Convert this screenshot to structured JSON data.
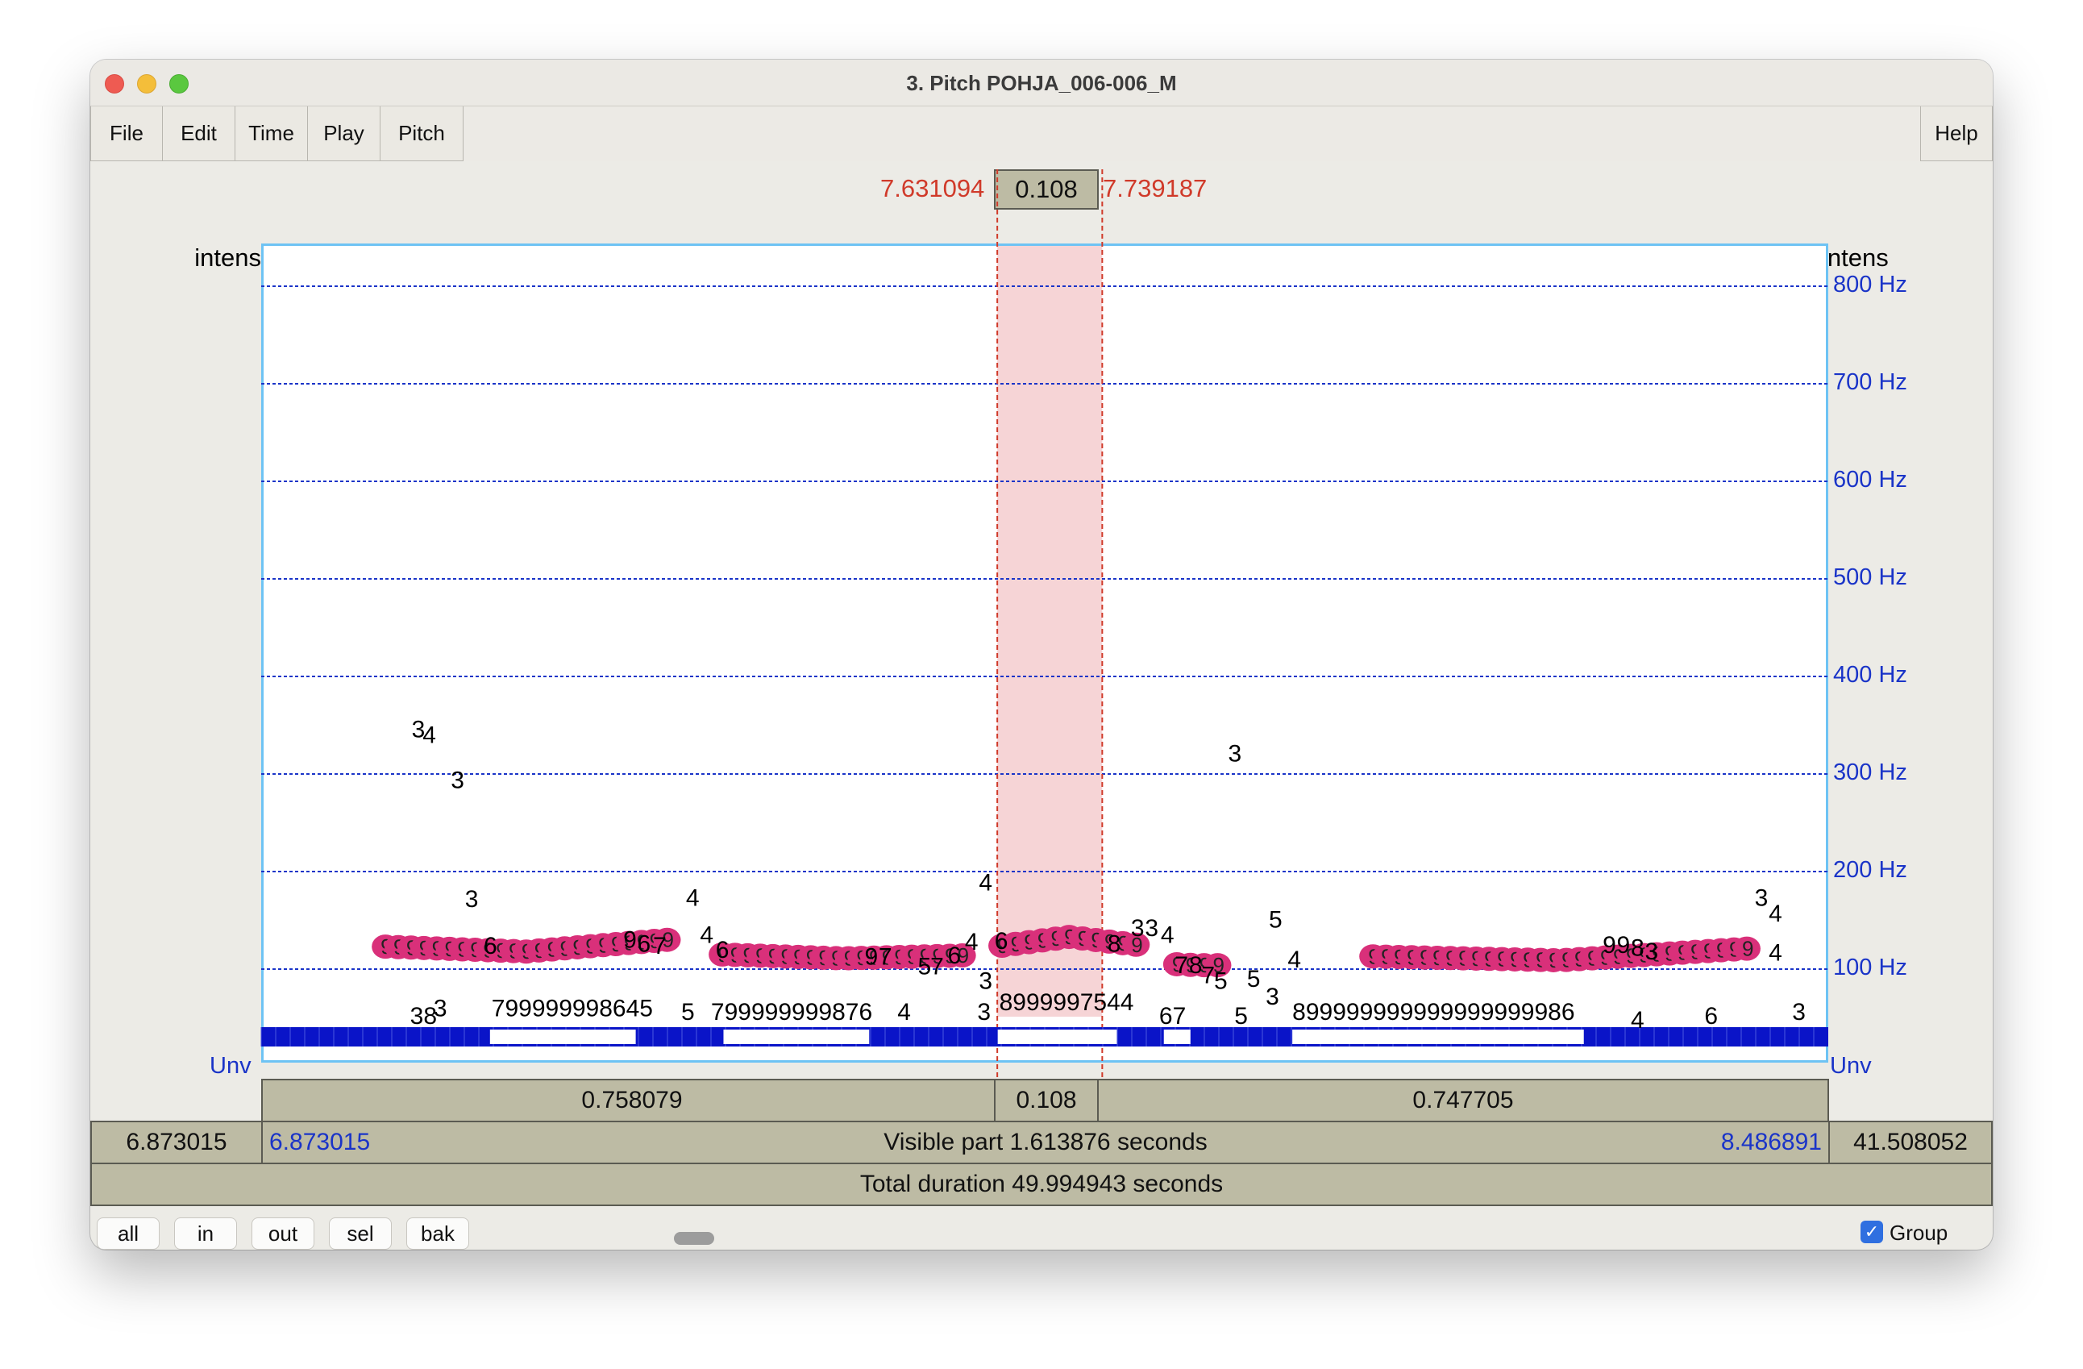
{
  "window": {
    "title": "3. Pitch POHJA_006-006_M"
  },
  "menu": {
    "file": "File",
    "edit": "Edit",
    "time": "Time",
    "play": "Play",
    "pitch": "Pitch",
    "help": "Help"
  },
  "selection": {
    "start": "7.631094",
    "duration": "0.108",
    "end": "7.739187"
  },
  "intensity": {
    "left_label": "intens",
    "digits": "111111111111111468888887631111433455444432111111113456776521133321111133333322233333333221111111111111111",
    "right_label": "intens"
  },
  "axis": {
    "hz_labels": [
      "800 Hz",
      "700 Hz",
      "600 Hz",
      "500 Hz",
      "400 Hz",
      "300 Hz",
      "200 Hz",
      "100 Hz"
    ],
    "unv_left": "Unv",
    "unv_right": "Unv"
  },
  "chart_data": {
    "type": "scatter",
    "title": "",
    "xlabel": "",
    "ylabel": "",
    "ylim": [
      0,
      800
    ],
    "y_unit": "Hz",
    "gridlines_hz": [
      800,
      700,
      600,
      500,
      400,
      300,
      200,
      100
    ],
    "voiced_tracks": [
      {
        "x_range": [
          7.001,
          7.291
        ],
        "y_start": 123,
        "y_mid": 118,
        "y_end": 130
      },
      {
        "x_range": [
          7.348,
          7.595
        ],
        "y_start": 115,
        "y_mid": 111,
        "y_end": 114
      },
      {
        "x_range": [
          7.636,
          7.774
        ],
        "y_start": 124,
        "y_mid": 133,
        "y_end": 125
      },
      {
        "x_range": [
          7.816,
          7.858
        ],
        "y_start": 105,
        "y_mid": 104,
        "y_end": 104
      },
      {
        "x_range": [
          8.018,
          8.403
        ],
        "y_start": 113,
        "y_mid": 109,
        "y_end": 121
      }
    ]
  },
  "candidates": [
    {
      "t": "3",
      "x": 0.096,
      "y": 246
    },
    {
      "t": "4",
      "x": 0.103,
      "y": 240
    },
    {
      "t": "3",
      "x": 0.121,
      "y": 194
    },
    {
      "t": "3",
      "x": 0.13,
      "y": 72
    },
    {
      "t": "6",
      "x": 0.142,
      "y": 24
    },
    {
      "t": "4",
      "x": 0.271,
      "y": 73
    },
    {
      "t": "4",
      "x": 0.28,
      "y": 35
    },
    {
      "t": "6",
      "x": 0.29,
      "y": 20
    },
    {
      "t": "5",
      "x": 0.419,
      "y": 3
    },
    {
      "t": "7",
      "x": 0.427,
      "y": 3
    },
    {
      "t": "6",
      "x": 0.438,
      "y": 14
    },
    {
      "t": "4",
      "x": 0.449,
      "y": 28
    },
    {
      "t": "4",
      "x": 0.458,
      "y": 89
    },
    {
      "t": "3",
      "x": 0.458,
      "y": -12
    },
    {
      "t": "6",
      "x": 0.468,
      "y": 29
    },
    {
      "t": "3",
      "x": 0.555,
      "y": 42
    },
    {
      "t": "3",
      "x": 0.564,
      "y": 42
    },
    {
      "t": "4",
      "x": 0.574,
      "y": 35
    },
    {
      "t": "7",
      "x": 0.583,
      "y": 4
    },
    {
      "t": "8",
      "x": 0.592,
      "y": 4
    },
    {
      "t": "7",
      "x": 0.6,
      "y": -6
    },
    {
      "t": "5",
      "x": 0.608,
      "y": -12
    },
    {
      "t": "3",
      "x": 0.617,
      "y": 221
    },
    {
      "t": "5",
      "x": 0.643,
      "y": 51
    },
    {
      "t": "4",
      "x": 0.655,
      "y": 10
    },
    {
      "t": "9",
      "x": 0.856,
      "y": 25
    },
    {
      "t": "9",
      "x": 0.865,
      "y": 25
    },
    {
      "t": "8",
      "x": 0.874,
      "y": 22
    },
    {
      "t": "3",
      "x": 0.883,
      "y": 18
    },
    {
      "t": "3",
      "x": 0.953,
      "y": 73
    },
    {
      "t": "4",
      "x": 0.962,
      "y": 57
    },
    {
      "t": "4",
      "x": 0.962,
      "y": 17
    },
    {
      "t": "9",
      "x": 0.231,
      "y": 30
    },
    {
      "t": "6",
      "x": 0.24,
      "y": 26
    },
    {
      "t": "7",
      "x": 0.25,
      "y": 24
    },
    {
      "t": "9",
      "x": 0.385,
      "y": 13
    },
    {
      "t": "7",
      "x": 0.394,
      "y": 13
    },
    {
      "t": "8",
      "x": 0.54,
      "y": 26
    },
    {
      "t": "5",
      "x": 0.629,
      "y": -10
    },
    {
      "t": "3",
      "x": 0.641,
      "y": -28
    }
  ],
  "bottom_rows": [
    {
      "t": "38",
      "x": 0.095,
      "y": -48
    },
    {
      "t": "3",
      "x": 0.11,
      "y": -40
    },
    {
      "t": "799999998645",
      "x": 0.147,
      "y": -40
    },
    {
      "t": "5",
      "x": 0.268,
      "y": -44
    },
    {
      "t": "799999999876",
      "x": 0.287,
      "y": -44
    },
    {
      "t": "4",
      "x": 0.406,
      "y": -44
    },
    {
      "t": "3",
      "x": 0.457,
      "y": -44
    },
    {
      "t": "8999997544",
      "x": 0.471,
      "y": -34
    },
    {
      "t": "67",
      "x": 0.573,
      "y": -48
    },
    {
      "t": "5",
      "x": 0.621,
      "y": -48
    },
    {
      "t": "899999999999999999986",
      "x": 0.658,
      "y": -44
    },
    {
      "t": "4",
      "x": 0.874,
      "y": -52
    },
    {
      "t": "6",
      "x": 0.921,
      "y": -48
    },
    {
      "t": "3",
      "x": 0.977,
      "y": -44
    }
  ],
  "voicing": {
    "voiced_segments": [
      [
        0.146,
        0.239
      ],
      [
        0.295,
        0.388
      ],
      [
        0.47,
        0.546
      ],
      [
        0.576,
        0.593
      ],
      [
        0.658,
        0.844
      ]
    ]
  },
  "segments": {
    "left": "0.758079",
    "selected": "0.108",
    "right": "0.747705"
  },
  "visible": {
    "left_outer": "6.873015",
    "left_inner": "6.873015",
    "label": "Visible part 1.613876 seconds",
    "right_inner": "8.486891",
    "right_outer": "41.508052"
  },
  "total": {
    "label": "Total duration 49.994943 seconds"
  },
  "footer": {
    "all": "all",
    "in": "in",
    "out": "out",
    "sel": "sel",
    "bak": "bak",
    "group_label": "Group",
    "group_checked": true
  },
  "colors": {
    "pitch_track": "#d9307a",
    "selection_fill": "#f6d4d6",
    "selection_line": "#d03a2a",
    "axis_blue": "#1a34c8",
    "voicing_bar": "#0a14c8",
    "plot_border": "#6ec3f4"
  }
}
